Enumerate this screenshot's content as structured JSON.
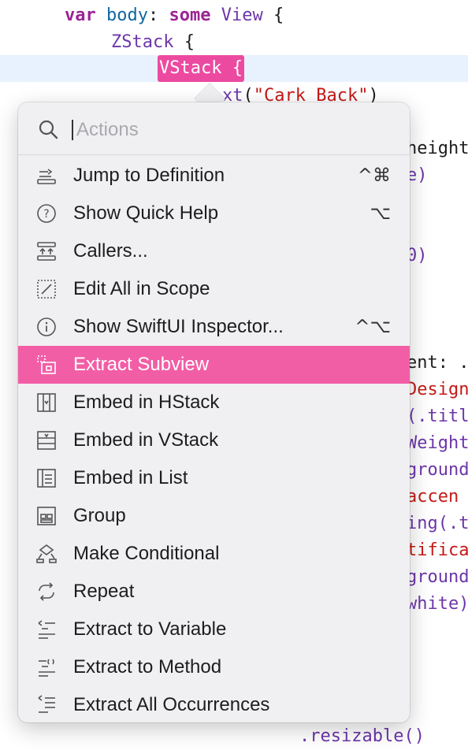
{
  "colors": {
    "selection": "#f25ea6",
    "token_highlight": "#ec4aa1",
    "keyword": "#9b2393",
    "type": "#0f68a0",
    "string": "#c41a16"
  },
  "code": {
    "line1": {
      "kw1": "var",
      "name": "body",
      "colon": ":",
      "kw2": "some",
      "type": "View",
      "brace": " {"
    },
    "line2": {
      "type": "ZStack",
      "brace": " {"
    },
    "line3": {
      "token": "VStack {"
    },
    "line4": {
      "fn": "xt",
      "lparen": "(",
      "str": "\"Cark Back\"",
      "rparen": ")"
    },
    "right_fragments": [
      {
        "text": "height",
        "class": "plain"
      },
      {
        "text": "e)",
        "class": "mix"
      },
      {
        "text": "0)",
        "class": "mix"
      },
      {
        "text": "ent: .",
        "class": "plain"
      },
      {
        "text": "Design",
        "class": "red"
      },
      {
        "text": "(.titl",
        "class": "purple"
      },
      {
        "text": "Weight",
        "class": "purple"
      },
      {
        "text": "ground",
        "class": "purple"
      },
      {
        "text": "accen",
        "class": "red"
      },
      {
        "text": "ing(.t",
        "class": "purple"
      },
      {
        "text": "tifica",
        "class": "red"
      },
      {
        "text": "ground",
        "class": "purple"
      },
      {
        "text": "white)",
        "class": "purple"
      }
    ],
    "bottom_line": {
      "text": ".resizable()"
    }
  },
  "popover": {
    "search": {
      "placeholder": "Actions",
      "value": "",
      "icon": "magnifier-icon"
    },
    "items": [
      {
        "label": "Jump to Definition",
        "icon": "jump-definition-icon",
        "shortcut": "^⌘"
      },
      {
        "label": "Show Quick Help",
        "icon": "question-circle-icon",
        "shortcut": "⌥"
      },
      {
        "label": "Callers...",
        "icon": "callers-icon",
        "shortcut": ""
      },
      {
        "label": "Edit All in Scope",
        "icon": "edit-scope-icon",
        "shortcut": ""
      },
      {
        "label": "Show SwiftUI Inspector...",
        "icon": "info-circle-icon",
        "shortcut": "^⌥"
      },
      {
        "label": "Extract Subview",
        "icon": "extract-subview-icon",
        "shortcut": "",
        "selected": true
      },
      {
        "label": "Embed in HStack",
        "icon": "embed-hstack-icon",
        "shortcut": ""
      },
      {
        "label": "Embed in VStack",
        "icon": "embed-vstack-icon",
        "shortcut": ""
      },
      {
        "label": "Embed in List",
        "icon": "embed-list-icon",
        "shortcut": ""
      },
      {
        "label": "Group",
        "icon": "group-icon",
        "shortcut": ""
      },
      {
        "label": "Make Conditional",
        "icon": "conditional-icon",
        "shortcut": ""
      },
      {
        "label": "Repeat",
        "icon": "repeat-icon",
        "shortcut": ""
      },
      {
        "label": "Extract to Variable",
        "icon": "extract-variable-icon",
        "shortcut": ""
      },
      {
        "label": "Extract to Method",
        "icon": "extract-method-icon",
        "shortcut": ""
      },
      {
        "label": "Extract All Occurrences",
        "icon": "extract-occurrences-icon",
        "shortcut": ""
      }
    ]
  }
}
